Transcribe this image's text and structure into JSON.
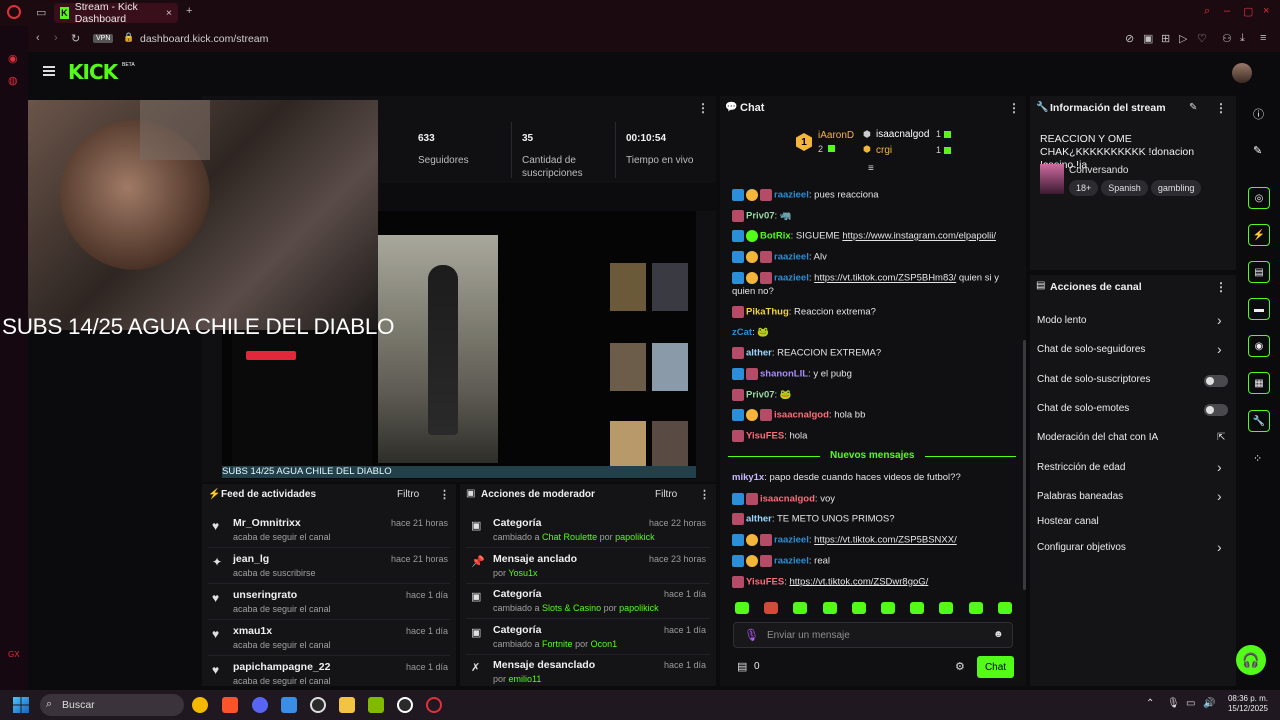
{
  "browser": {
    "tab_title": "Stream - Kick Dashboard",
    "url": "dashboard.kick.com/stream",
    "vpn_label": "VPN"
  },
  "app": {
    "logo": "KICK",
    "beta": "BETA"
  },
  "overlay": {
    "text": "SUBS 14/25 AGUA CHILE DEL DIABLO"
  },
  "stats": [
    {
      "value": "633",
      "label": "Seguidores"
    },
    {
      "value": "35",
      "label": "Cantidad de suscripciones"
    },
    {
      "value": "00:10:54",
      "label": "Tiempo en vivo"
    }
  ],
  "video": {
    "caption": "SUBS 14/25 AGUA CHILE DEL DIABLO"
  },
  "activity": {
    "title": "Feed de actividades",
    "filter": "Filtro",
    "items": [
      {
        "name": "Mr_Omnitrixx",
        "sub": "acaba de seguir el canal",
        "time": "hace 21 horas",
        "icon": "heart-icon"
      },
      {
        "name": "jean_lg",
        "sub": "acaba de suscribirse",
        "time": "hace 21 horas",
        "icon": "sparkle-icon"
      },
      {
        "name": "unseringrato",
        "sub": "acaba de seguir el canal",
        "time": "hace 1 día",
        "icon": "heart-icon"
      },
      {
        "name": "xmau1x",
        "sub": "acaba de seguir el canal",
        "time": "hace 1 día",
        "icon": "heart-icon"
      },
      {
        "name": "papichampagne_22",
        "sub": "acaba de seguir el canal",
        "time": "hace 1 día",
        "icon": "heart-icon"
      }
    ]
  },
  "mod_actions": {
    "title": "Acciones de moderador",
    "filter": "Filtro",
    "items": [
      {
        "title": "Categoría",
        "pre": "cambiado a",
        "target": "Chat Roulette",
        "mid": "por",
        "by": "papolikick",
        "time": "hace 22 horas"
      },
      {
        "title": "Mensaje anclado",
        "pre": "por",
        "target": "",
        "mid": "",
        "by": "Yosu1x",
        "time": "hace 23 horas"
      },
      {
        "title": "Categoría",
        "pre": "cambiado a",
        "target": "Slots & Casino",
        "mid": "por",
        "by": "papolikick",
        "time": "hace 1 día"
      },
      {
        "title": "Categoría",
        "pre": "cambiado a",
        "target": "Fortnite",
        "mid": "por",
        "by": "Ocon1",
        "time": "hace 1 día"
      },
      {
        "title": "Mensaje desanclado",
        "pre": "por",
        "target": "",
        "mid": "",
        "by": "emilio11",
        "time": "hace 1 día"
      }
    ]
  },
  "chat": {
    "title": "Chat",
    "leaderboard": [
      {
        "rank": "1",
        "name": "iAaronD",
        "count": "2"
      },
      {
        "name": "isaacnalgod",
        "count": "1"
      },
      {
        "name": "crgi",
        "count": "1"
      }
    ],
    "messages": [
      {
        "user": "raazieel",
        "text": "pues reacciona",
        "color": "#2a8fd8",
        "badges": [
          "blue",
          "sub",
          "pink"
        ]
      },
      {
        "user": "Priv07",
        "text": "🦏",
        "color": "#9bd8a8",
        "badges": [
          "pink"
        ]
      },
      {
        "user": "BotRix",
        "text": "SIGUEME ",
        "link": "https://www.instagram.com/elpapolii/",
        "color": "#53fc18",
        "badges": [
          "blue",
          "green"
        ]
      },
      {
        "user": "raazieel",
        "text": "Alv",
        "color": "#2a8fd8",
        "badges": [
          "blue",
          "sub",
          "pink"
        ]
      },
      {
        "user": "raazieel",
        "text": " quien si y",
        "link": "https://vt.tiktok.com/ZSP5BHm83/",
        "color": "#2a8fd8",
        "badges": [
          "blue",
          "sub",
          "pink"
        ]
      },
      {
        "user": "",
        "text": "quien no?",
        "color": "#e4e4e4",
        "badges": []
      },
      {
        "user": "PikaThug",
        "text": "Reaccion extrema?",
        "color": "#f3d53b",
        "badges": [
          "pink"
        ]
      },
      {
        "user": "zCat",
        "text": "🐸",
        "color": "#2a8fd8",
        "badges": []
      },
      {
        "user": "alther",
        "text": "REACCION EXTREMA?",
        "color": "#9bd8ff",
        "badges": [
          "pink"
        ]
      },
      {
        "user": "shanonLIL",
        "text": "y el pubg",
        "color": "#a78bfa",
        "badges": [
          "blue",
          "pink"
        ]
      },
      {
        "user": "Priv07",
        "text": "🐸",
        "color": "#9bd8a8",
        "badges": [
          "pink"
        ]
      },
      {
        "user": "isaacnalgod",
        "text": "hola bb",
        "color": "#ff6b7a",
        "badges": [
          "blue",
          "sub",
          "pink"
        ]
      },
      {
        "user": "YisuFES",
        "text": "hola",
        "color": "#ff6b7a",
        "badges": [
          "pink"
        ]
      }
    ],
    "new_messages_label": "Nuevos mensajes",
    "new_messages": [
      {
        "user": "miky1x",
        "text": "papo desde cuando haces videos de futbol??",
        "color": "#c9b8ff",
        "badges": []
      },
      {
        "user": "isaacnalgod",
        "text": "voy",
        "color": "#ff6b7a",
        "badges": [
          "blue",
          "pink"
        ]
      },
      {
        "user": "alther",
        "text": "TE METO UNOS PRIMOS?",
        "color": "#9bd8ff",
        "badges": [
          "pink"
        ]
      },
      {
        "user": "raazieel",
        "text": "",
        "link": "https://vt.tiktok.com/ZSP5BSNXX/",
        "color": "#2a8fd8",
        "badges": [
          "blue",
          "sub",
          "pink"
        ]
      },
      {
        "user": "raazieel",
        "text": "real",
        "color": "#2a8fd8",
        "badges": [
          "blue",
          "sub",
          "pink"
        ]
      },
      {
        "user": "YisuFES",
        "text": "",
        "link": "https://vt.tiktok.com/ZSDwr8goG/",
        "color": "#ff6b7a",
        "badges": [
          "pink"
        ]
      }
    ],
    "input_placeholder": "Enviar un mensaje",
    "points": "0",
    "send_label": "Chat"
  },
  "stream_info": {
    "title": "Información del stream",
    "stream_title": "REACCION Y OME CHAK¿KKKKKKKKKK !donacion !casino !ia",
    "category": "Conversando",
    "tags": [
      "18+",
      "Spanish",
      "gambling"
    ]
  },
  "channel_actions": {
    "title": "Acciones de canal",
    "items": [
      {
        "label": "Modo lento",
        "control": "chevron"
      },
      {
        "label": "Chat de solo-seguidores",
        "control": "chevron"
      },
      {
        "label": "Chat de solo-suscriptores",
        "control": "toggle"
      },
      {
        "label": "Chat de solo-emotes",
        "control": "toggle"
      },
      {
        "label": "Moderación del chat con IA",
        "control": "external"
      },
      {
        "label": "Restricción de edad",
        "control": "chevron"
      },
      {
        "label": "Palabras baneadas",
        "control": "chevron"
      },
      {
        "label": "Hostear canal",
        "control": "none"
      },
      {
        "label": "Configurar objetivos",
        "control": "chevron"
      }
    ]
  },
  "taskbar": {
    "search_placeholder": "Buscar",
    "time": "08:36 p. m.",
    "date": "15/12/2025"
  },
  "colors": {
    "accent": "#53fc18",
    "bg": "#0b0b0d",
    "panel": "#141416"
  }
}
